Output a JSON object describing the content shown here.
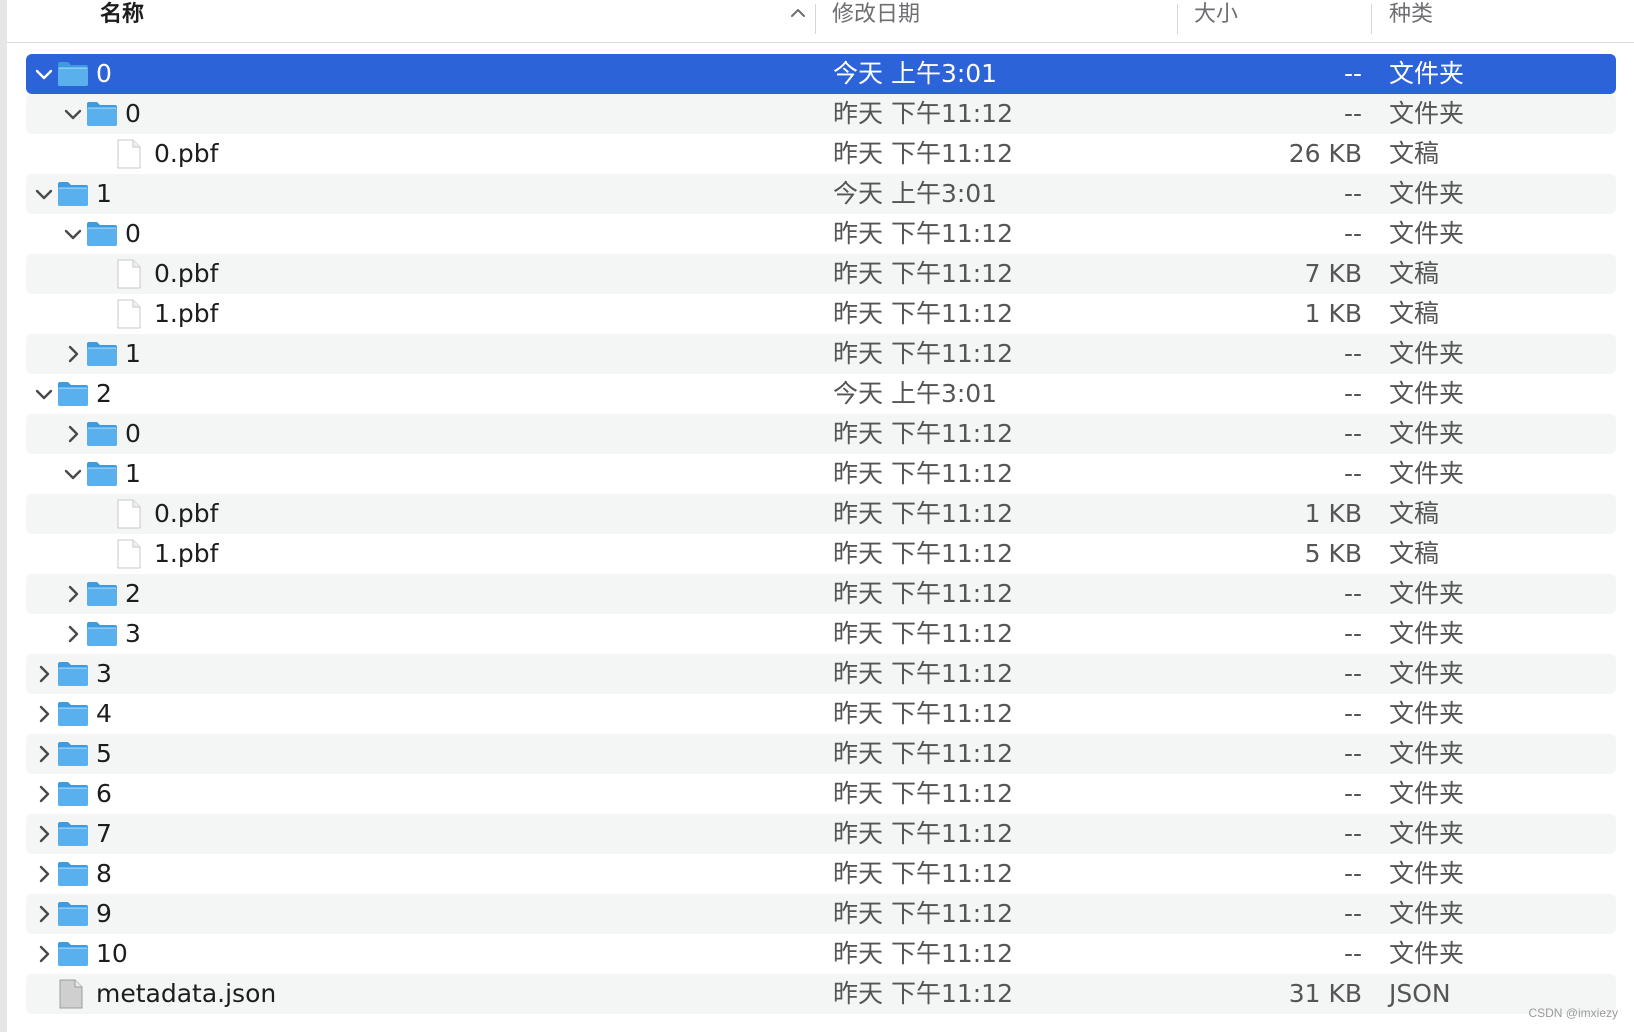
{
  "header": {
    "name": "名称",
    "date": "修改日期",
    "size": "大小",
    "kind": "种类"
  },
  "rows": [
    {
      "level": 0,
      "type": "folder",
      "expanded": true,
      "name": "0",
      "date": "今天 上午3:01",
      "size": "--",
      "kind": "文件夹",
      "selected": true
    },
    {
      "level": 1,
      "type": "folder",
      "expanded": true,
      "name": "0",
      "date": "昨天 下午11:12",
      "size": "--",
      "kind": "文件夹"
    },
    {
      "level": 2,
      "type": "file",
      "name": "0.pbf",
      "date": "昨天 下午11:12",
      "size": "26 KB",
      "kind": "文稿"
    },
    {
      "level": 0,
      "type": "folder",
      "expanded": true,
      "name": "1",
      "date": "今天 上午3:01",
      "size": "--",
      "kind": "文件夹"
    },
    {
      "level": 1,
      "type": "folder",
      "expanded": true,
      "name": "0",
      "date": "昨天 下午11:12",
      "size": "--",
      "kind": "文件夹"
    },
    {
      "level": 2,
      "type": "file",
      "name": "0.pbf",
      "date": "昨天 下午11:12",
      "size": "7 KB",
      "kind": "文稿"
    },
    {
      "level": 2,
      "type": "file",
      "name": "1.pbf",
      "date": "昨天 下午11:12",
      "size": "1 KB",
      "kind": "文稿"
    },
    {
      "level": 1,
      "type": "folder",
      "expanded": false,
      "name": "1",
      "date": "昨天 下午11:12",
      "size": "--",
      "kind": "文件夹"
    },
    {
      "level": 0,
      "type": "folder",
      "expanded": true,
      "name": "2",
      "date": "今天 上午3:01",
      "size": "--",
      "kind": "文件夹"
    },
    {
      "level": 1,
      "type": "folder",
      "expanded": false,
      "name": "0",
      "date": "昨天 下午11:12",
      "size": "--",
      "kind": "文件夹"
    },
    {
      "level": 1,
      "type": "folder",
      "expanded": true,
      "name": "1",
      "date": "昨天 下午11:12",
      "size": "--",
      "kind": "文件夹"
    },
    {
      "level": 2,
      "type": "file",
      "name": "0.pbf",
      "date": "昨天 下午11:12",
      "size": "1 KB",
      "kind": "文稿"
    },
    {
      "level": 2,
      "type": "file",
      "name": "1.pbf",
      "date": "昨天 下午11:12",
      "size": "5 KB",
      "kind": "文稿"
    },
    {
      "level": 1,
      "type": "folder",
      "expanded": false,
      "name": "2",
      "date": "昨天 下午11:12",
      "size": "--",
      "kind": "文件夹"
    },
    {
      "level": 1,
      "type": "folder",
      "expanded": false,
      "name": "3",
      "date": "昨天 下午11:12",
      "size": "--",
      "kind": "文件夹"
    },
    {
      "level": 0,
      "type": "folder",
      "expanded": false,
      "name": "3",
      "date": "昨天 下午11:12",
      "size": "--",
      "kind": "文件夹"
    },
    {
      "level": 0,
      "type": "folder",
      "expanded": false,
      "name": "4",
      "date": "昨天 下午11:12",
      "size": "--",
      "kind": "文件夹"
    },
    {
      "level": 0,
      "type": "folder",
      "expanded": false,
      "name": "5",
      "date": "昨天 下午11:12",
      "size": "--",
      "kind": "文件夹"
    },
    {
      "level": 0,
      "type": "folder",
      "expanded": false,
      "name": "6",
      "date": "昨天 下午11:12",
      "size": "--",
      "kind": "文件夹"
    },
    {
      "level": 0,
      "type": "folder",
      "expanded": false,
      "name": "7",
      "date": "昨天 下午11:12",
      "size": "--",
      "kind": "文件夹"
    },
    {
      "level": 0,
      "type": "folder",
      "expanded": false,
      "name": "8",
      "date": "昨天 下午11:12",
      "size": "--",
      "kind": "文件夹"
    },
    {
      "level": 0,
      "type": "folder",
      "expanded": false,
      "name": "9",
      "date": "昨天 下午11:12",
      "size": "--",
      "kind": "文件夹"
    },
    {
      "level": 0,
      "type": "folder",
      "expanded": false,
      "name": "10",
      "date": "昨天 下午11:12",
      "size": "--",
      "kind": "文件夹"
    },
    {
      "level": 0,
      "type": "json",
      "name": "metadata.json",
      "date": "昨天 下午11:12",
      "size": "31 KB",
      "kind": "JSON"
    }
  ],
  "watermark": "CSDN @imxiezy",
  "colors": {
    "selection": "#2d63d8",
    "folder": "#5ab0ec",
    "alt_row": "#f4f5f5"
  }
}
